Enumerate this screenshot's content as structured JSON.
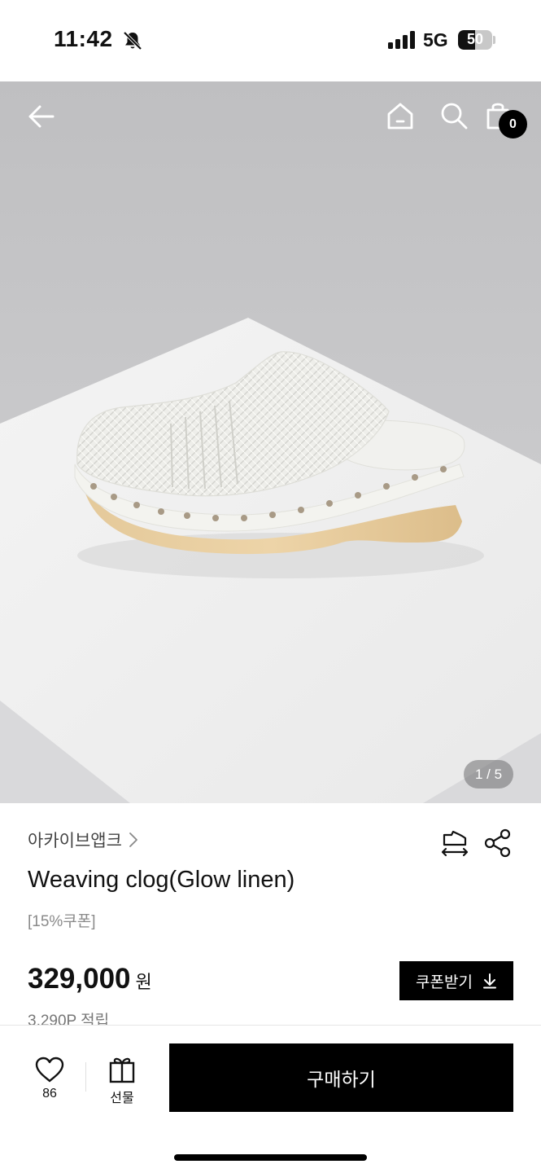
{
  "status_bar": {
    "time": "11:42",
    "network": "5G",
    "battery": "50",
    "battery_level_pct": 50,
    "icons": [
      "bell-slash-icon",
      "signal-icon",
      "battery-icon"
    ]
  },
  "header": {
    "icons": [
      "back-arrow-icon",
      "home-icon",
      "search-icon",
      "shopping-bag-icon"
    ],
    "cart_count": "0"
  },
  "hero": {
    "image_counter": "1 / 5",
    "image_subject": "white woven clog on wooden sole"
  },
  "product": {
    "brand": "아카이브앱크",
    "title": "Weaving clog(Glow linen)",
    "coupon_tag": "[15%쿠폰]",
    "price": "329,000",
    "price_unit": "원",
    "points": "3,290P 적립",
    "coupon_button_label": "쿠폰받기",
    "icons": [
      "chevron-right-icon",
      "size-guide-icon",
      "share-icon",
      "download-icon"
    ]
  },
  "bottom_bar": {
    "like_count": "86",
    "gift_label": "선물",
    "buy_label": "구매하기",
    "icons": [
      "heart-icon",
      "gift-icon"
    ]
  },
  "colors": {
    "primary": "#000000",
    "background": "#ffffff",
    "hero_background": "#cfcfd1",
    "muted_text": "#8a8a8a"
  }
}
